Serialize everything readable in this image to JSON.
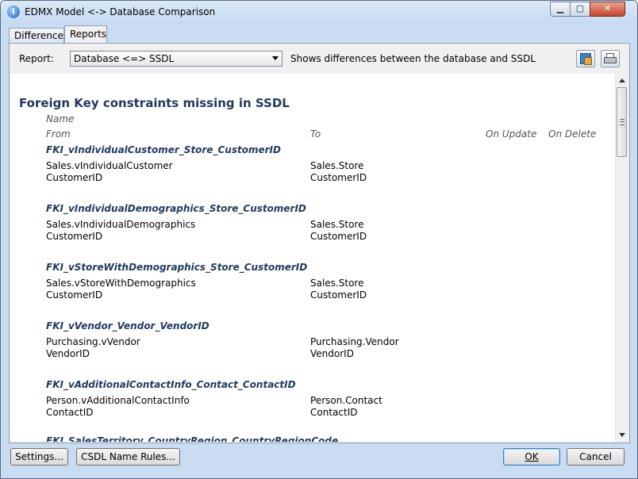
{
  "window": {
    "title": "EDMX Model <-> Database Comparison"
  },
  "tabs": [
    "Differences",
    "Reports"
  ],
  "report": {
    "label": "Report:",
    "selected": "Database <=> SSDL",
    "description": "Shows differences between the database and SSDL"
  },
  "section": {
    "title": "Foreign Key constraints missing in SSDL",
    "headers": {
      "name": "Name",
      "from": "From",
      "to": "To",
      "on_update": "On Update",
      "on_delete": "On Delete"
    }
  },
  "constraints": [
    {
      "name": "FKI_vIndividualCustomer_Store_CustomerID",
      "from_table": "Sales.vIndividualCustomer",
      "from_col": "CustomerID",
      "to_table": "Sales.Store",
      "to_col": "CustomerID"
    },
    {
      "name": "FKI_vIndividualDemographics_Store_CustomerID",
      "from_table": "Sales.vIndividualDemographics",
      "from_col": "CustomerID",
      "to_table": "Sales.Store",
      "to_col": "CustomerID"
    },
    {
      "name": "FKI_vStoreWithDemographics_Store_CustomerID",
      "from_table": "Sales.vStoreWithDemographics",
      "from_col": "CustomerID",
      "to_table": "Sales.Store",
      "to_col": "CustomerID"
    },
    {
      "name": "FKI_vVendor_Vendor_VendorID",
      "from_table": "Purchasing.vVendor",
      "from_col": "VendorID",
      "to_table": "Purchasing.Vendor",
      "to_col": "VendorID"
    },
    {
      "name": "FKI_vAdditionalContactInfo_Contact_ContactID",
      "from_table": "Person.vAdditionalContactInfo",
      "from_col": "ContactID",
      "to_table": "Person.Contact",
      "to_col": "ContactID"
    },
    {
      "name": "FKI_SalesTerritory_CountryRegion_CountryRegionCode",
      "from_table": "",
      "from_col": "",
      "to_table": "",
      "to_col": ""
    }
  ],
  "buttons": {
    "settings": "Settings...",
    "rules": "CSDL Name Rules...",
    "ok": "OK",
    "cancel": "Cancel"
  }
}
